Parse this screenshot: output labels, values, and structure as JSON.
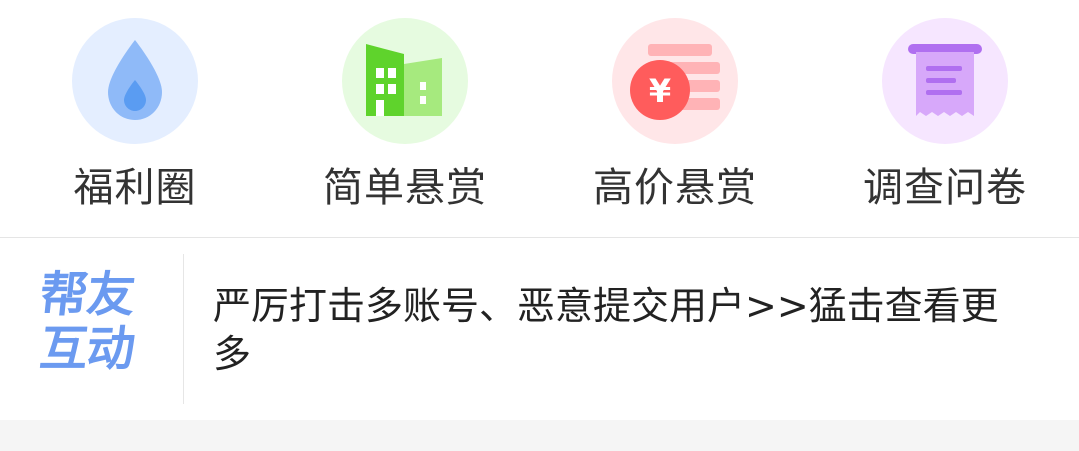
{
  "menu": {
    "items": [
      {
        "label": "福利圈",
        "icon": "water-drop-icon",
        "color": "#5ea1f5",
        "bg": "#e4eeff"
      },
      {
        "label": "简单悬赏",
        "icon": "buildings-icon",
        "color": "#5fd32c",
        "bg": "#e6fbe0"
      },
      {
        "label": "高价悬赏",
        "icon": "yuan-coin-icon",
        "color": "#ff5c5c",
        "bg": "#ffe6e8"
      },
      {
        "label": "调查问卷",
        "icon": "receipt-icon",
        "color": "#b06ff0",
        "bg": "#f6e6ff"
      }
    ]
  },
  "notice": {
    "logo_line1": "帮友",
    "logo_line2": "互动",
    "text": "严厉打击多账号、恶意提交用户>>猛击查看更多"
  }
}
